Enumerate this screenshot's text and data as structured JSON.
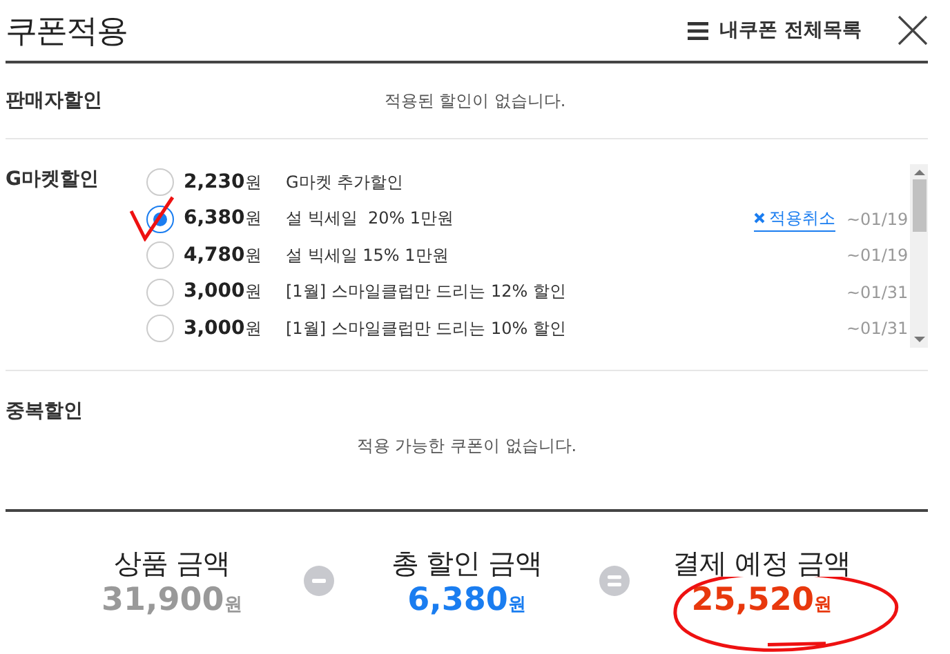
{
  "header": {
    "title": "쿠폰적용",
    "link": "내쿠폰 전체목록"
  },
  "sections": [
    {
      "kind": "inline",
      "label": "판매자할인",
      "message": "적용된 할인이 없습니다."
    },
    {
      "kind": "coupons",
      "label": "G마켓할인",
      "coupons": [
        {
          "amount": "2,230",
          "unit": "원",
          "name": "G마켓 추가할인",
          "selected": false
        },
        {
          "amount": "6,380",
          "unit": "원",
          "name": "설 빅세일  20% 1만원",
          "selected": true,
          "cancel": "적용취소",
          "expiry": "~01/19"
        },
        {
          "amount": "4,780",
          "unit": "원",
          "name": "설 빅세일 15% 1만원",
          "selected": false,
          "expiry": "~01/19"
        },
        {
          "amount": "3,000",
          "unit": "원",
          "name": "[1월] 스마일클럽만 드리는 12% 할인",
          "selected": false,
          "expiry": "~01/31"
        },
        {
          "amount": "3,000",
          "unit": "원",
          "name": "[1월] 스마일클럽만 드리는 10% 할인",
          "selected": false,
          "expiry": "~01/31"
        }
      ]
    },
    {
      "kind": "below",
      "label": "중복할인",
      "message": "적용 가능한 쿠폰이 없습니다."
    }
  ],
  "summary": [
    {
      "kind": "term",
      "label": "상품 금액",
      "amount": "31,900",
      "unit": "원",
      "color": "#999999"
    },
    {
      "kind": "minus"
    },
    {
      "kind": "term",
      "label": "총 할인 금액",
      "amount": "6,380",
      "unit": "원",
      "color": "#1a7df0"
    },
    {
      "kind": "equals"
    },
    {
      "kind": "term",
      "label": "결제 예정 금액",
      "amount": "25,520",
      "unit": "원",
      "color": "#e8380d"
    }
  ],
  "annotations": {
    "check_mark": true,
    "circle": true
  }
}
